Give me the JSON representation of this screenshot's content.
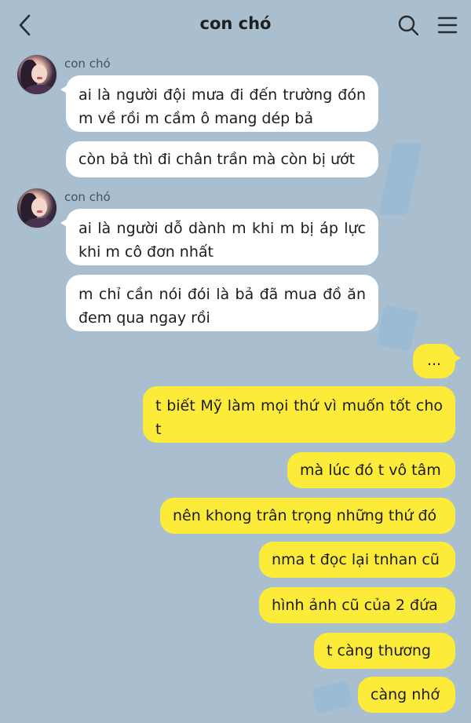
{
  "header": {
    "title": "con chó",
    "icons": {
      "back": "chevron-left-icon",
      "search": "search-icon",
      "menu": "menu-icon"
    }
  },
  "colors": {
    "background": "#a9bfd0",
    "incoming_bubble": "#ffffff",
    "outgoing_bubble": "#fdeb3a"
  },
  "messages": {
    "group1": {
      "sender": "con chó",
      "bubbles": [
        "ai là người đội mưa đi đến trường đón m về rồi m cầm ô mang dép bả",
        "còn bả thì đi chân trần mà còn bị ướt"
      ]
    },
    "group2": {
      "sender": "con chó",
      "bubbles": [
        "ai là người dỗ dành m khi m bị áp lực khi m cô đơn nhất",
        "m chỉ cần nói đói là bả đã mua đồ ăn đem qua ngay rồi"
      ]
    },
    "outgoing": [
      "...",
      "t biết Mỹ làm mọi thứ vì muốn tốt cho t",
      "mà lúc đó t vô tâm",
      "nên khong trân trọng những thứ đó",
      "nma t đọc lại tnhan cũ",
      "hình ảnh cũ của 2 đứa",
      "t càng thương",
      "càng nhớ"
    ]
  }
}
